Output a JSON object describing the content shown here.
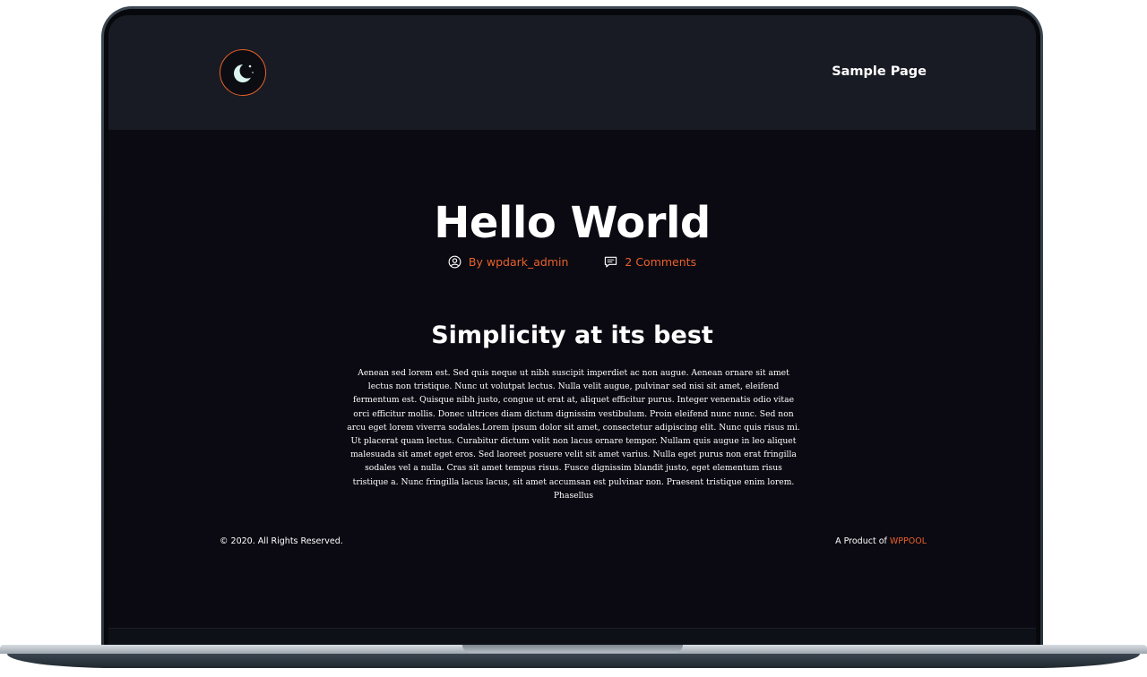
{
  "header": {
    "logo_icon": "moon-icon",
    "nav_link": "Sample Page"
  },
  "post": {
    "title": "Hello World",
    "author": "By wpdark_admin",
    "comments": "2 Comments",
    "subtitle": "Simplicity at its best",
    "body": "Aenean sed lorem est. Sed quis neque ut nibh suscipit imperdiet ac non augue. Aenean ornare sit amet lectus non tristique. Nunc ut volutpat lectus. Nulla velit augue, pulvinar sed nisi sit amet, eleifend fermentum est. Quisque nibh justo, congue ut erat at, aliquet efficitur purus. Integer venenatis odio vitae orci efficitur mollis. Donec ultrices diam dictum dignissim vestibulum. Proin eleifend nunc nunc. Sed non arcu eget lorem viverra sodales.Lorem ipsum dolor sit amet, consectetur adipiscing elit. Nunc quis risus mi. Ut placerat quam lectus. Curabitur dictum velit non lacus ornare tempor. Nullam quis augue in leo aliquet malesuada sit amet eget eros. Sed laoreet posuere velit sit amet varius. Nulla eget purus non erat fringilla sodales vel a nulla. Cras sit amet tempus risus. Fusce dignissim blandit justo, eget elementum risus tristique a. Nunc fringilla lacus lacus, sit amet accumsan est pulvinar non. Praesent tristique enim lorem. Phasellus"
  },
  "footer": {
    "copyright": "©  2020. All Rights Reserved.",
    "product_prefix": "A Product of ",
    "product_link": "WPPOOL"
  },
  "colors": {
    "accent": "#e9612a",
    "header_bg": "#181b23",
    "page_bg": "#0b0a12",
    "text": "#ffffff"
  }
}
